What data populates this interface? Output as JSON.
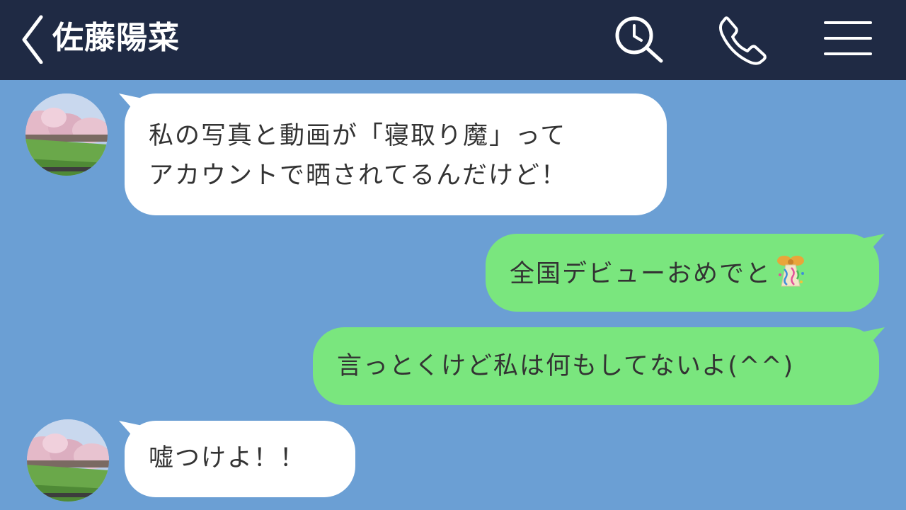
{
  "header": {
    "title": "佐藤陽菜",
    "back_icon": "chevron-left-icon",
    "search_icon": "search-icon",
    "call_icon": "phone-icon",
    "menu_icon": "menu-icon"
  },
  "colors": {
    "header_bg": "#1f2a44",
    "chat_bg": "#6b9fd4",
    "incoming_bubble": "#ffffff",
    "outgoing_bubble": "#7ae67e",
    "text": "#333333"
  },
  "messages": [
    {
      "direction": "incoming",
      "text": "私の写真と動画が「寝取り魔」って\nアカウントで晒されてるんだけど！"
    },
    {
      "direction": "outgoing",
      "text": "全国デビューおめでと",
      "emoji": "party-popper-icon"
    },
    {
      "direction": "outgoing",
      "text": "言っとくけど私は何もしてないよ(^^)"
    },
    {
      "direction": "incoming",
      "text": "嘘つけよ！！"
    }
  ]
}
